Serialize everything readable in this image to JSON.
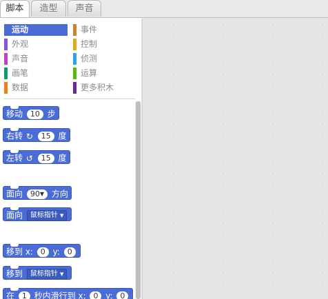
{
  "tabs": [
    {
      "label": "脚本"
    },
    {
      "label": "造型"
    },
    {
      "label": "声音"
    }
  ],
  "categories": [
    {
      "label": "运动",
      "color": "#4a6cd4"
    },
    {
      "label": "事件",
      "color": "#c88330"
    },
    {
      "label": "外观",
      "color": "#8a55d7"
    },
    {
      "label": "控制",
      "color": "#e1a91a"
    },
    {
      "label": "声音",
      "color": "#bb42c3"
    },
    {
      "label": "侦测",
      "color": "#2ca5e2"
    },
    {
      "label": "画笔",
      "color": "#0e9a6c"
    },
    {
      "label": "运算",
      "color": "#5cb712"
    },
    {
      "label": "数据",
      "color": "#ee7d16"
    },
    {
      "label": "更多积木",
      "color": "#632d99"
    }
  ],
  "blocks": {
    "move": {
      "pre": "移动",
      "value": "10",
      "post": "步"
    },
    "turn_right": {
      "pre": "右转",
      "value": "15",
      "post": "度"
    },
    "turn_left": {
      "pre": "左转",
      "value": "15",
      "post": "度"
    },
    "point_direction": {
      "pre": "面向",
      "value": "90",
      "post": "方向"
    },
    "point_towards": {
      "pre": "面向",
      "option": "鼠标指针"
    },
    "goto_xy": {
      "pre": "移到 x:",
      "x": "0",
      "mid": "y:",
      "y": "0"
    },
    "goto": {
      "pre": "移到",
      "option": "鼠标指针"
    },
    "glide": {
      "pre": "在",
      "secs": "1",
      "mid": "秒内滑行到 x:",
      "x": "0",
      "mid2": "y:",
      "y": "0"
    }
  },
  "icons": {
    "turn_right": "rotate-clockwise-icon",
    "turn_left": "rotate-counterclockwise-icon",
    "dropdown": "dropdown-arrow-icon"
  }
}
